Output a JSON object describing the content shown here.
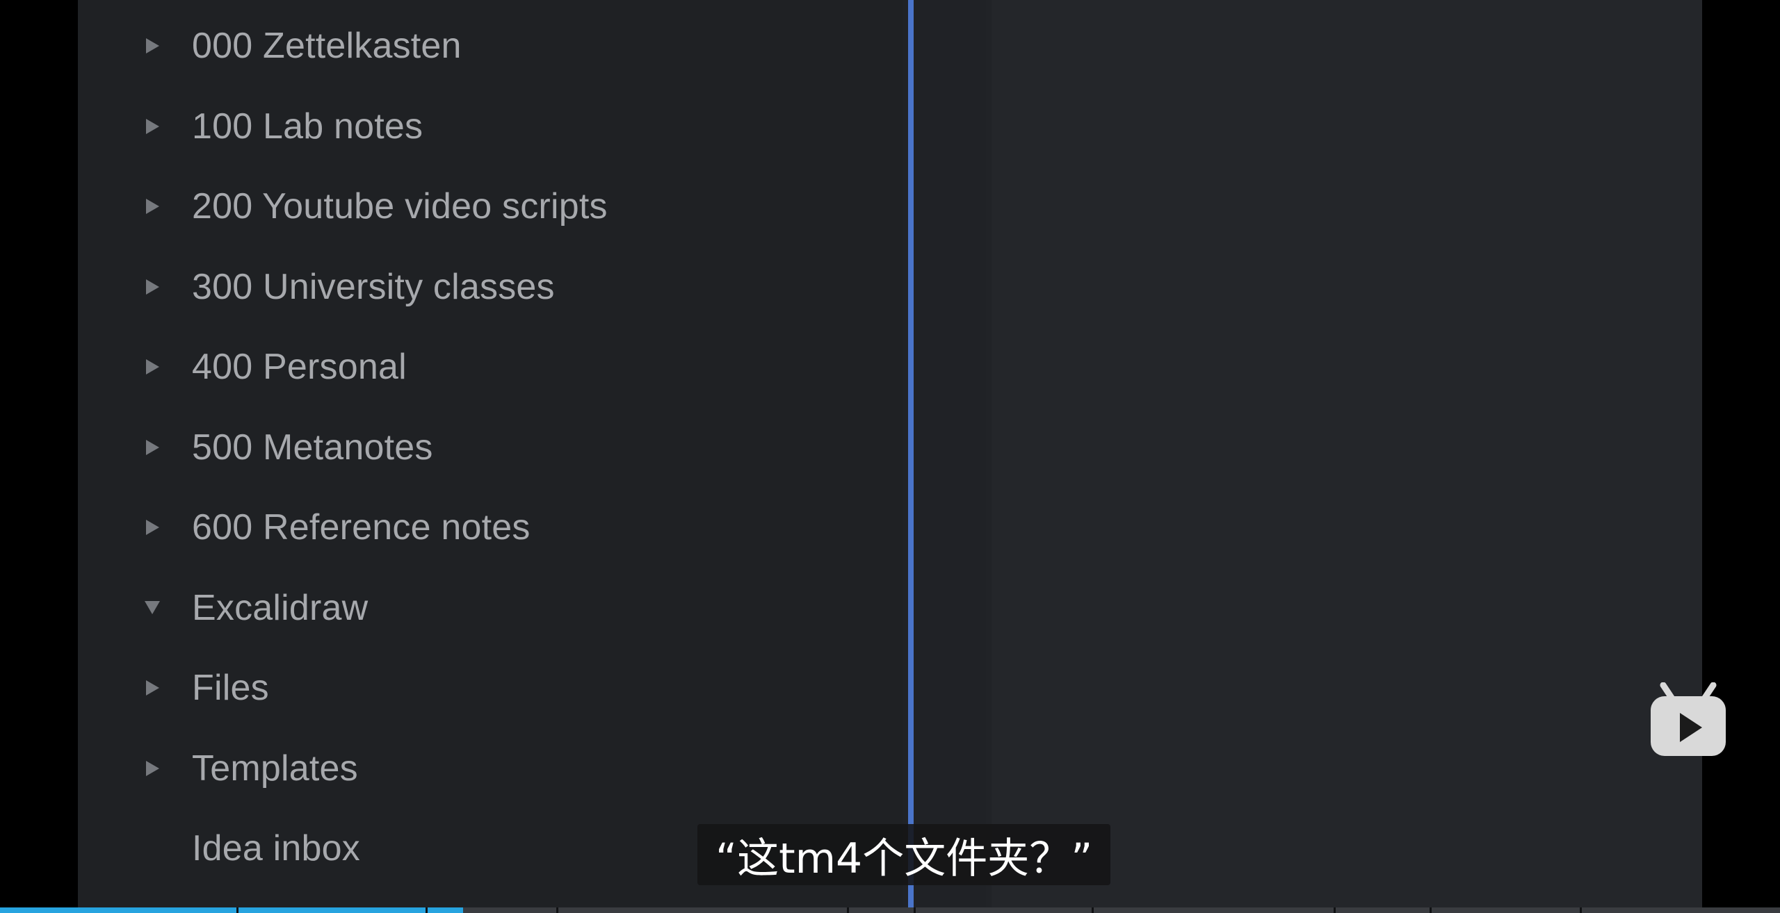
{
  "file_explorer": {
    "items": [
      {
        "label": "000 Zettelkasten",
        "expanded": false,
        "folder": true
      },
      {
        "label": "100 Lab notes",
        "expanded": false,
        "folder": true
      },
      {
        "label": "200 Youtube video scripts",
        "expanded": false,
        "folder": true
      },
      {
        "label": "300 University classes",
        "expanded": false,
        "folder": true
      },
      {
        "label": "400 Personal",
        "expanded": false,
        "folder": true
      },
      {
        "label": "500 Metanotes",
        "expanded": false,
        "folder": true
      },
      {
        "label": "600 Reference notes",
        "expanded": false,
        "folder": true
      },
      {
        "label": "Excalidraw",
        "expanded": true,
        "folder": true
      },
      {
        "label": "Files",
        "expanded": false,
        "folder": true
      },
      {
        "label": "Templates",
        "expanded": false,
        "folder": true
      },
      {
        "label": "Idea inbox",
        "expanded": false,
        "folder": false
      }
    ]
  },
  "video": {
    "subtitle": "“这tm4个文件夹？”",
    "logo_icon": "bilibili-tv-icon",
    "progress": 0.26
  },
  "colors": {
    "background": "#000000",
    "explorer_bg": "#1f2124",
    "editor_bg": "#24262a",
    "divider": "#4a74c9",
    "label_text": "#a7a9ad",
    "progress_fill": "#27a4e0"
  }
}
